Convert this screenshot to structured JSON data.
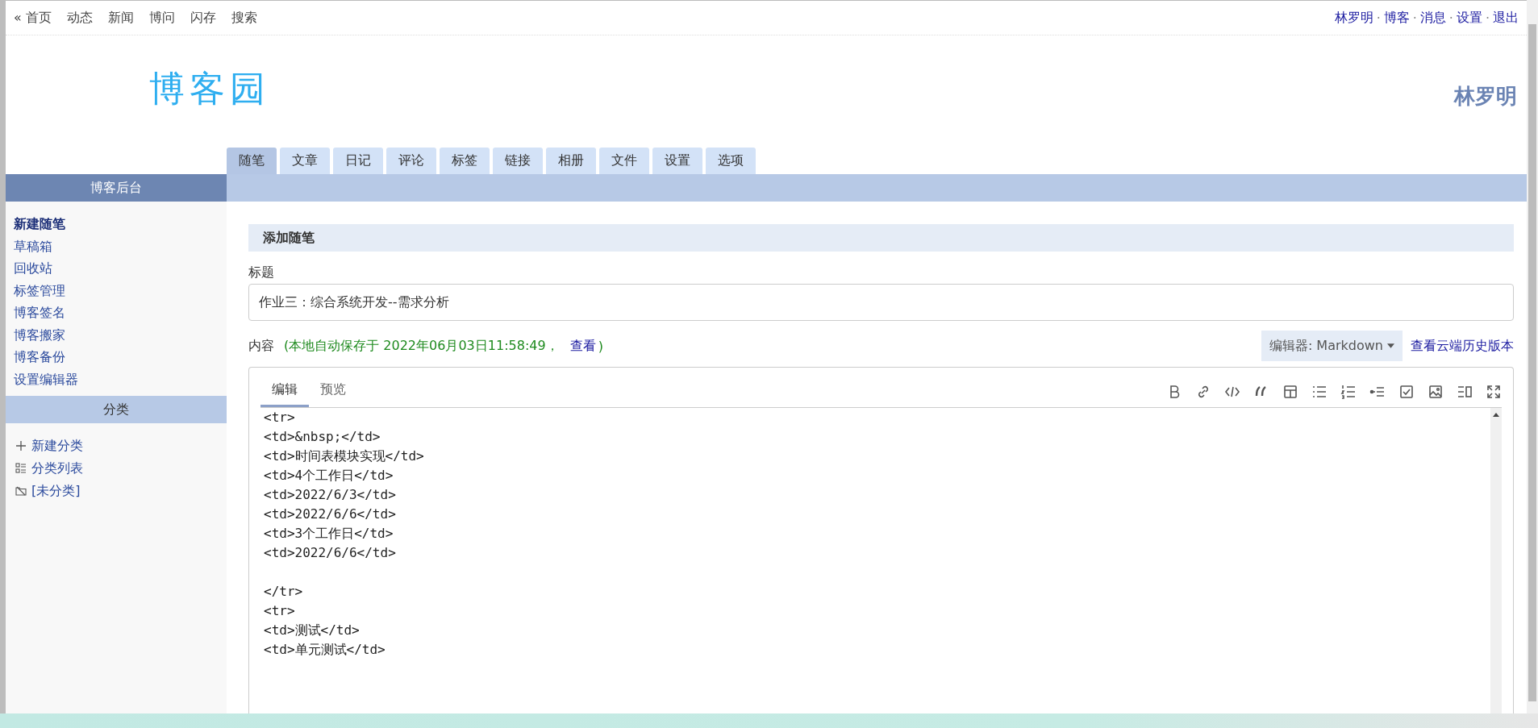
{
  "top_nav": {
    "left_links": [
      "« 首页",
      "动态",
      "新闻",
      "博问",
      "闪存",
      "搜索"
    ],
    "right_links": [
      "林罗明",
      "博客",
      "消息",
      "设置",
      "退出"
    ],
    "separator": "·"
  },
  "logo": "博客园",
  "blog_owner": "林罗明",
  "tabs": [
    {
      "label": "随笔",
      "selected": true
    },
    {
      "label": "文章",
      "selected": false
    },
    {
      "label": "日记",
      "selected": false
    },
    {
      "label": "评论",
      "selected": false
    },
    {
      "label": "标签",
      "selected": false
    },
    {
      "label": "链接",
      "selected": false
    },
    {
      "label": "相册",
      "selected": false
    },
    {
      "label": "文件",
      "selected": false
    },
    {
      "label": "设置",
      "selected": false
    },
    {
      "label": "选项",
      "selected": false
    }
  ],
  "sidebar": {
    "title": "博客后台",
    "links": [
      {
        "label": "新建随笔",
        "selected": true
      },
      {
        "label": "草稿箱",
        "selected": false
      },
      {
        "label": "回收站",
        "selected": false
      },
      {
        "label": "标签管理",
        "selected": false
      },
      {
        "label": "博客签名",
        "selected": false
      },
      {
        "label": "博客搬家",
        "selected": false
      },
      {
        "label": "博客备份",
        "selected": false
      },
      {
        "label": "设置编辑器",
        "selected": false
      }
    ],
    "category_title": "分类",
    "category_links": [
      {
        "kind": "add",
        "label": "新建分类"
      },
      {
        "kind": "list",
        "label": "分类列表"
      },
      {
        "kind": "folder",
        "label": "[未分类]"
      }
    ]
  },
  "form": {
    "section_title": "添加随笔",
    "title_label": "标题",
    "title_value": "作业三：综合系统开发--需求分析",
    "content_label": "内容",
    "autosave_text": "(本地自动保存于 2022年06月03日11:58:49，",
    "autosave_link": "查看",
    "autosave_close": ")",
    "editor_button": "编辑器: Markdown",
    "history_link": "查看云端历史版本"
  },
  "editor": {
    "tabs": [
      {
        "label": "编辑",
        "selected": true
      },
      {
        "label": "预览",
        "selected": false
      }
    ],
    "content": "<tr>\n<td>&nbsp;</td>\n<td>时间表模块实现</td>\n<td>4个工作日</td>\n<td>2022/6/3</td>\n<td>2022/6/6</td>\n<td>3个工作日</td>\n<td>2022/6/6</td>\n\n</tr>\n<tr>\n<td>测试</td>\n<td>单元测试</td>"
  }
}
